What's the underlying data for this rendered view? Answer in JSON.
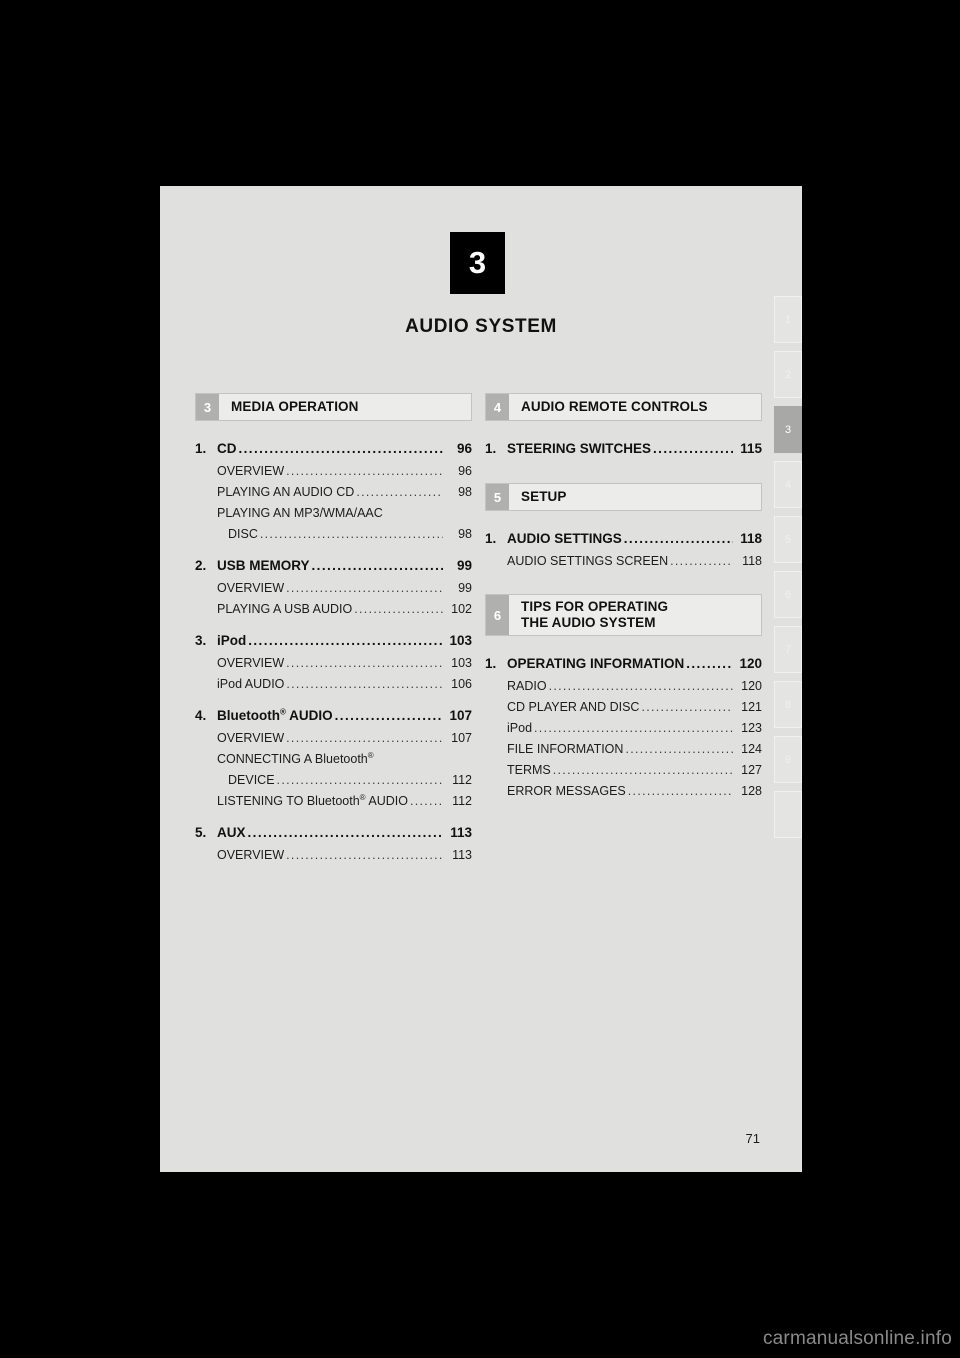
{
  "chapter": {
    "number": "3",
    "title": "AUDIO SYSTEM"
  },
  "page_number": "71",
  "watermark": "carmanualsonline.info",
  "colors": {
    "page_background": "#e0e0de",
    "canvas": "#000000",
    "badge": "#000000",
    "section_number_badge": "#b0b0ae",
    "section_bar": "#ececeb",
    "active_tab": "#a8a8a6",
    "inactive_tab": "#e4e4e2"
  },
  "columns": {
    "left": [
      {
        "header": {
          "number": "3",
          "label": "MEDIA OPERATION"
        },
        "entries": [
          {
            "index": "1.",
            "title": "CD",
            "page": "96",
            "subs": [
              {
                "title": "OVERVIEW",
                "page": "96"
              },
              {
                "title": "PLAYING AN AUDIO CD",
                "page": "98"
              },
              {
                "title": "PLAYING AN MP3/WMA/AAC",
                "cont": "DISC",
                "page": "98"
              }
            ]
          },
          {
            "index": "2.",
            "title": "USB MEMORY",
            "page": "99",
            "subs": [
              {
                "title": "OVERVIEW",
                "page": "99"
              },
              {
                "title": "PLAYING A USB AUDIO",
                "page": "102"
              }
            ]
          },
          {
            "index": "3.",
            "title": "iPod",
            "page": "103",
            "subs": [
              {
                "title": "OVERVIEW",
                "page": "103"
              },
              {
                "title": "iPod AUDIO",
                "page": "106"
              }
            ]
          },
          {
            "index": "4.",
            "title_pre": "Bluetooth",
            "title_sup": "®",
            "title_post": " AUDIO",
            "page": "107",
            "subs": [
              {
                "title": "OVERVIEW",
                "page": "107"
              },
              {
                "title_pre": "CONNECTING A Bluetooth",
                "title_sup": "®",
                "cont": "DEVICE",
                "page": "112"
              },
              {
                "title_pre": "LISTENING TO Bluetooth",
                "title_sup": "®",
                "title_post": " AUDIO",
                "page": "112"
              }
            ]
          },
          {
            "index": "5.",
            "title": "AUX",
            "page": "113",
            "subs": [
              {
                "title": "OVERVIEW",
                "page": "113"
              }
            ]
          }
        ]
      }
    ],
    "right": [
      {
        "header": {
          "number": "4",
          "label": "AUDIO REMOTE CONTROLS"
        },
        "entries": [
          {
            "index": "1.",
            "title": "STEERING SWITCHES",
            "page": "115",
            "subs": []
          }
        ]
      },
      {
        "header": {
          "number": "5",
          "label": "SETUP"
        },
        "entries": [
          {
            "index": "1.",
            "title": "AUDIO SETTINGS",
            "page": "118",
            "subs": [
              {
                "title": "AUDIO SETTINGS SCREEN",
                "page": "118"
              }
            ]
          }
        ]
      },
      {
        "header": {
          "number": "6",
          "label_line1": "TIPS FOR OPERATING",
          "label_line2": "THE AUDIO SYSTEM"
        },
        "entries": [
          {
            "index": "1.",
            "title": "OPERATING INFORMATION",
            "page": "120",
            "subs": [
              {
                "title": "RADIO",
                "page": "120"
              },
              {
                "title": "CD PLAYER AND DISC",
                "page": "121"
              },
              {
                "title": "iPod",
                "page": "123"
              },
              {
                "title": "FILE INFORMATION",
                "page": "124"
              },
              {
                "title": "TERMS",
                "page": "127"
              },
              {
                "title": "ERROR MESSAGES",
                "page": "128"
              }
            ]
          }
        ]
      }
    ]
  },
  "side_tabs": [
    {
      "label": "1",
      "active": false
    },
    {
      "label": "2",
      "active": false
    },
    {
      "label": "3",
      "active": true
    },
    {
      "label": "4",
      "active": false
    },
    {
      "label": "5",
      "active": false
    },
    {
      "label": "6",
      "active": false
    },
    {
      "label": "7",
      "active": false
    },
    {
      "label": "8",
      "active": false
    },
    {
      "label": "9",
      "active": false
    },
    {
      "label": "",
      "active": false
    }
  ]
}
